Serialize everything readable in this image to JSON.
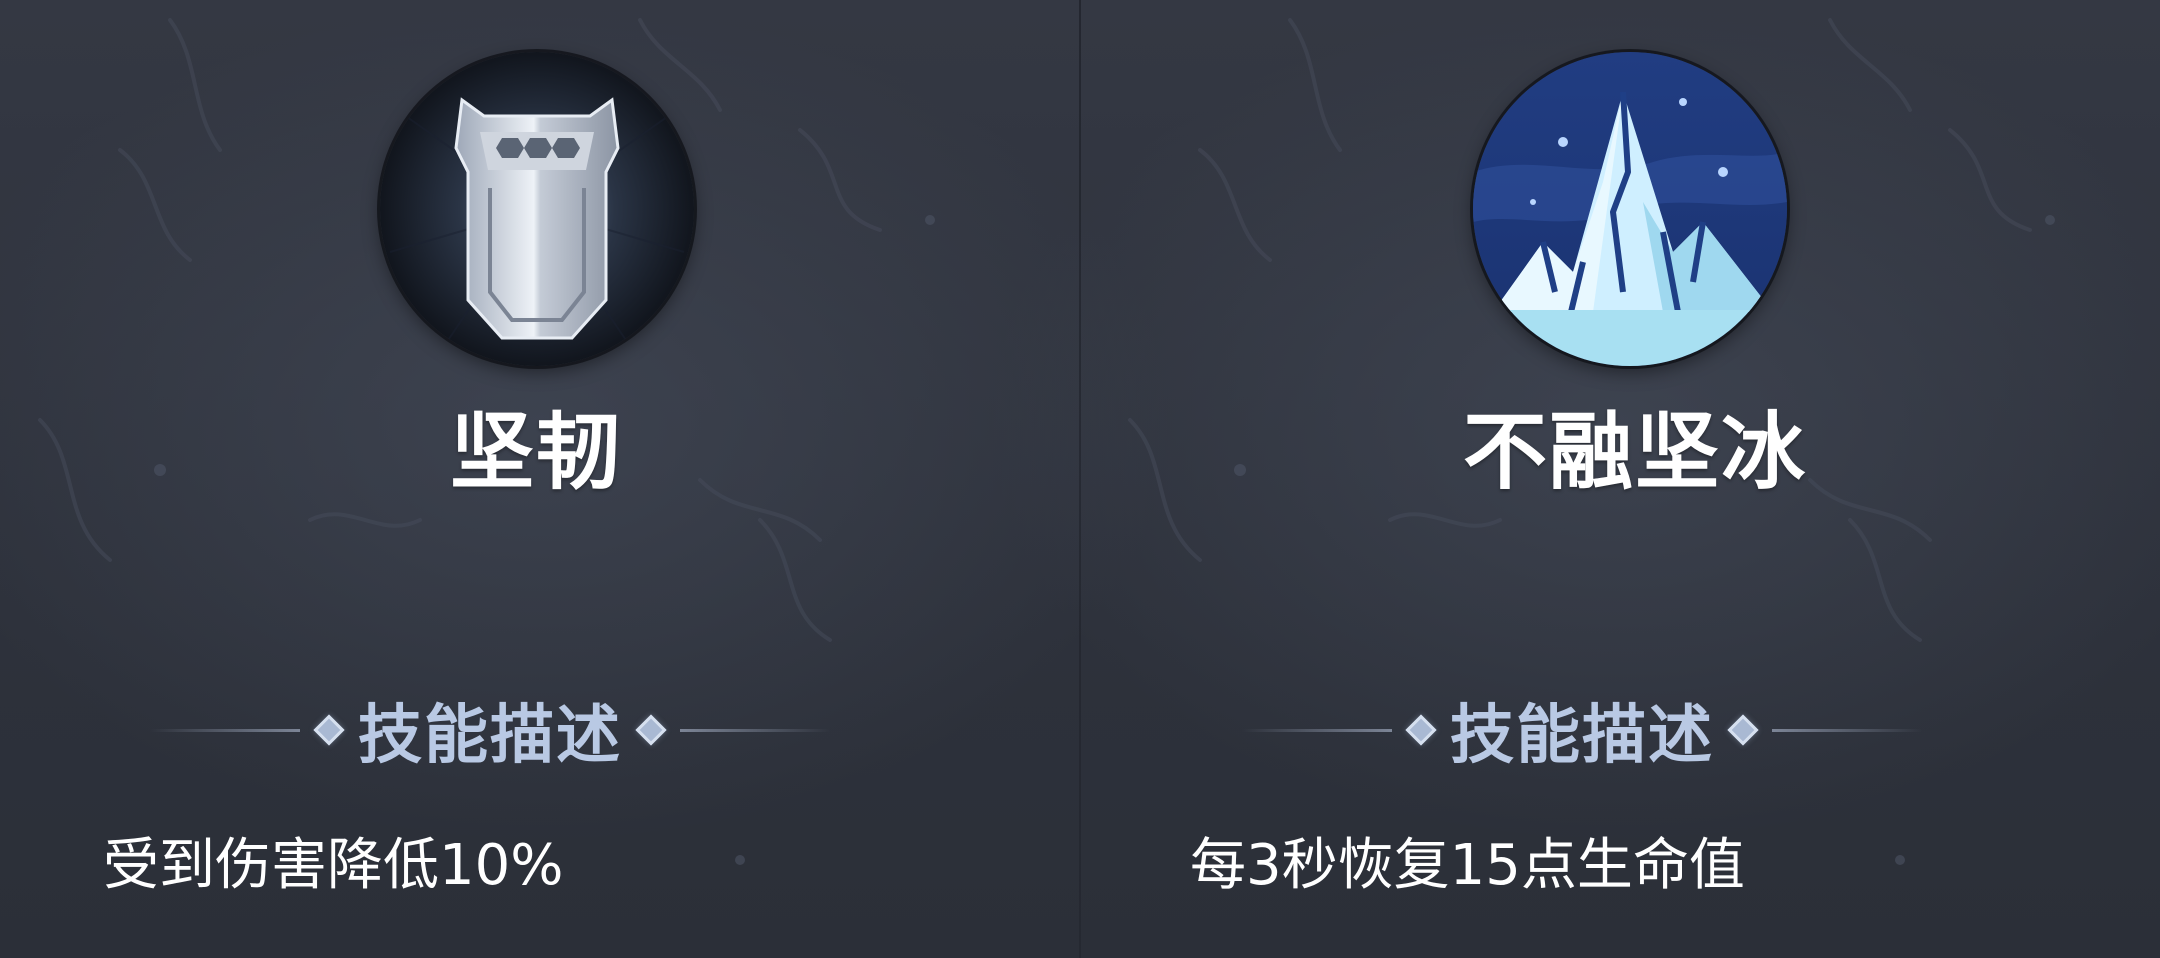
{
  "skills": [
    {
      "name": "坚韧",
      "icon": "shield-icon",
      "section_title": "技能描述",
      "description": "受到伤害降低10%"
    },
    {
      "name": "不融坚冰",
      "icon": "ice-mountain-icon",
      "section_title": "技能描述",
      "description": "每3秒恢复15点生命值"
    }
  ],
  "colors": {
    "background": "#2f333d",
    "name_text": "#ffffff",
    "section_title": "#b9c9e4",
    "description_text": "#ffffff",
    "diamond": "#a9b9d3",
    "ice_icon_bg": "#1f3f86",
    "ice_icon_highlight": "#cfefff"
  }
}
